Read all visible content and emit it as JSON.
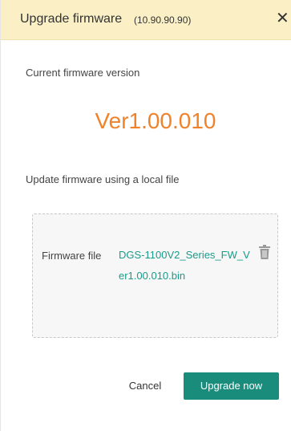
{
  "header": {
    "title": "Upgrade firmware",
    "ip": "(10.90.90.90)",
    "close_glyph": "✕"
  },
  "current": {
    "label": "Current firmware version",
    "version": "Ver1.00.010"
  },
  "update": {
    "label": "Update firmware using a local file",
    "file_label": "Firmware file",
    "file_name": "DGS-1100V2_Series_FW_Ver1.00.010.bin"
  },
  "actions": {
    "cancel_label": "Cancel",
    "upgrade_label": "Upgrade now"
  },
  "colors": {
    "header_bg": "#fbf0c5",
    "version": "#f0822a",
    "link": "#1a9b8a",
    "primary_button": "#1a8c7c"
  },
  "icons": {
    "close": "close-icon",
    "delete": "trash-icon"
  }
}
